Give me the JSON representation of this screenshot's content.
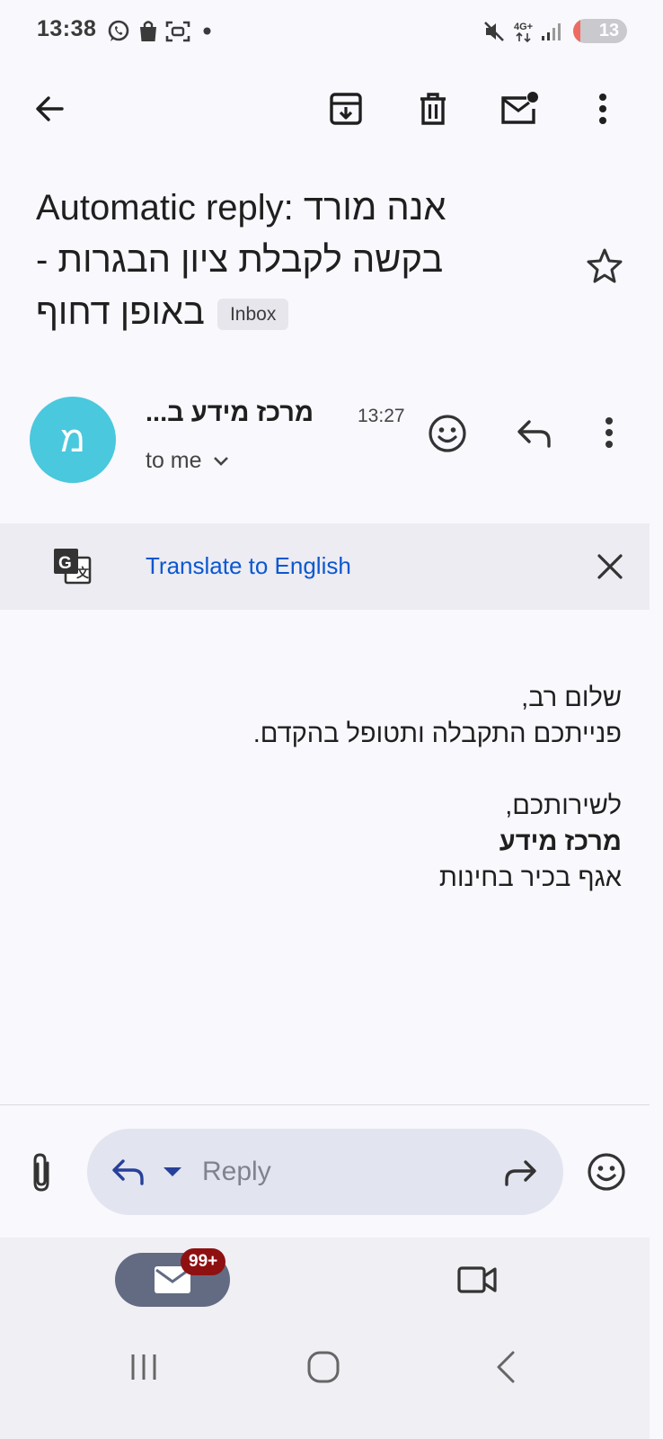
{
  "status_bar": {
    "time": "13:38",
    "left_icons": [
      "whatsapp-icon",
      "shopping-bag-icon",
      "screenshot-icon",
      "dot-icon"
    ],
    "right_icons": [
      "mute-icon",
      "4g-plus-icon",
      "signal-icon"
    ],
    "network": "4G+",
    "battery_level": "13"
  },
  "toolbar": {
    "icons": [
      "back-arrow-icon",
      "archive-icon",
      "delete-icon",
      "mark-unread-icon",
      "more-vert-icon"
    ]
  },
  "subject": {
    "line1": "Automatic reply: אנה מורד",
    "line2": "בקשה לקבלת ציון הבגרות -",
    "line3": "באופן דחוף",
    "label": "Inbox"
  },
  "sender": {
    "avatar_letter": "מ",
    "avatar_color": "#4ac8dd",
    "name": "מרכז מידע ב...",
    "time": "13:27",
    "recipient": "to me"
  },
  "translate": {
    "link_text": "Translate to English"
  },
  "body": {
    "greeting": "שלום רב,",
    "line1": "פנייתכם התקבלה ותטופל בהקדם.",
    "signoff": "לשירותכם,",
    "sender_bold": "מרכז מידע",
    "department": "אגף בכיר בחינות"
  },
  "reply_bar": {
    "placeholder": "Reply"
  },
  "bottom_nav": {
    "mail_badge": "99+"
  },
  "colors": {
    "link": "#0b57d0",
    "badge": "#8f1010",
    "mail_pill": "#626b82"
  }
}
